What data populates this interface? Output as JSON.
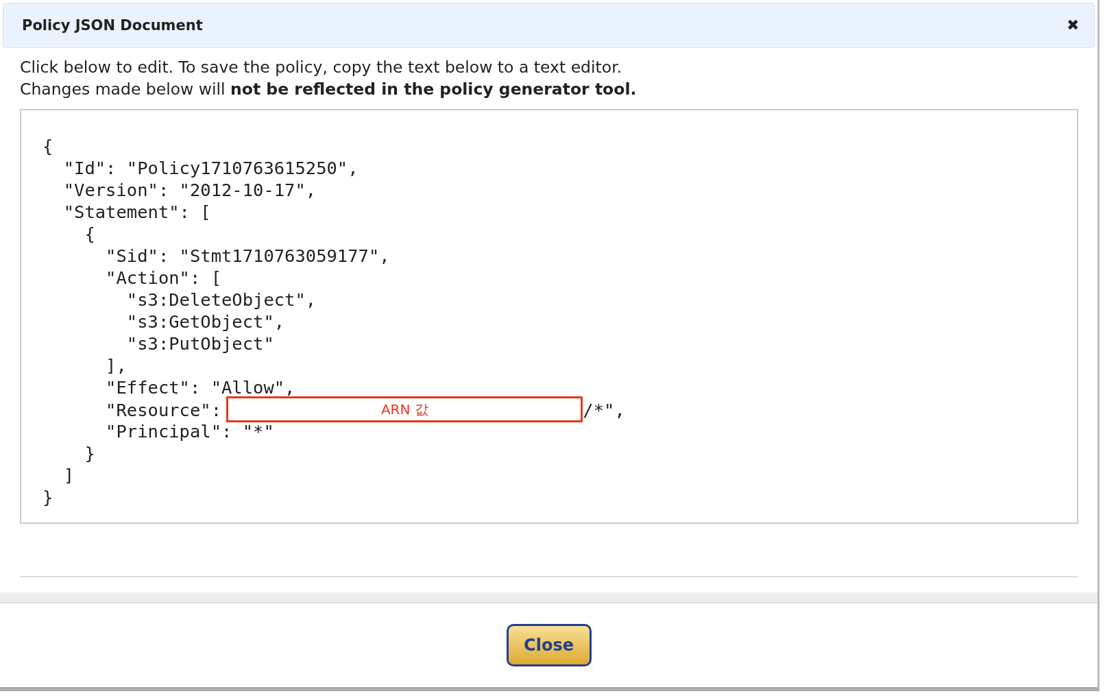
{
  "dialog": {
    "title": "Policy JSON Document",
    "close_icon": "✖"
  },
  "instructions": [
    "Click below to edit. To save the policy, copy the text below to a text editor.",
    "Changes made below will **not be reflected in the policy generator tool.**"
  ],
  "editor": {
    "lines": [
      {
        "kind": "code",
        "text": "{"
      },
      {
        "kind": "code",
        "text": "  \"Id\": \"Policy1710763615250\","
      },
      {
        "kind": "code",
        "text": "  \"Version\": \"2012-10-17\","
      },
      {
        "kind": "code",
        "text": "  \"Statement\": ["
      },
      {
        "kind": "code",
        "text": "    {"
      },
      {
        "kind": "code",
        "text": "      \"Sid\": \"Stmt1710763059177\","
      },
      {
        "kind": "code",
        "text": "      \"Action\": ["
      },
      {
        "kind": "code",
        "text": "        \"s3:DeleteObject\","
      },
      {
        "kind": "code",
        "text": "        \"s3:GetObject\","
      },
      {
        "kind": "code",
        "text": "        \"s3:PutObject\""
      },
      {
        "kind": "code",
        "text": "      ],"
      },
      {
        "kind": "code",
        "text": "      \"Effect\": \"Allow\","
      },
      {
        "kind": "redacted",
        "before": "      \"Resource\": ",
        "label": "ARN 값",
        "after": "/*\","
      },
      {
        "kind": "code",
        "text": "      \"Principal\": \"*\""
      },
      {
        "kind": "code",
        "text": "    }"
      },
      {
        "kind": "code",
        "text": "  ]"
      },
      {
        "kind": "code",
        "text": "}"
      }
    ]
  },
  "footer": {
    "button": "Close"
  }
}
